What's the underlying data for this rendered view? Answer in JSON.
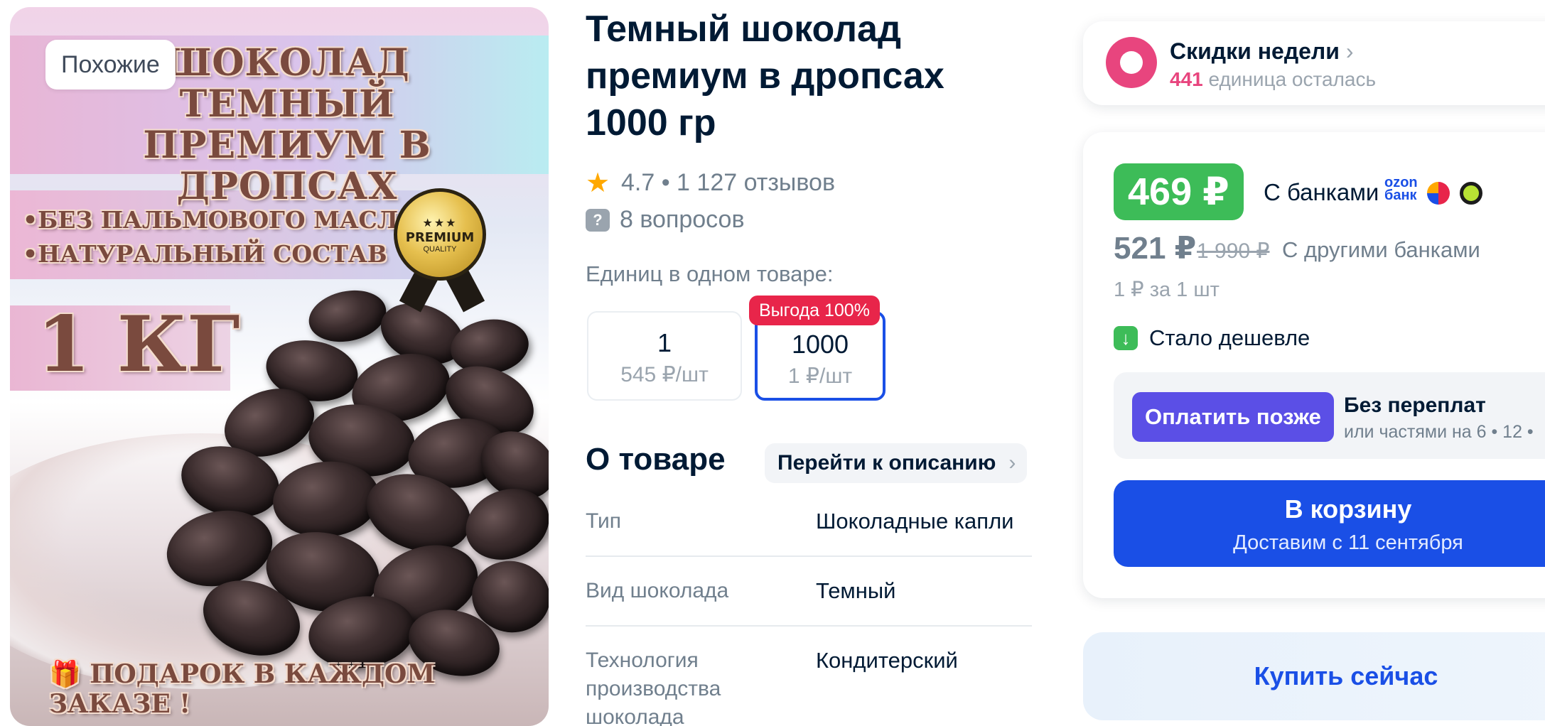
{
  "gallery": {
    "similar_chip": "Похожие",
    "image_title": "ШОКОЛАД ТЕМНЫЙ ПРЕМИУМ В ДРОПСАХ",
    "feature_1": "•БЕЗ ПАЛЬМОВОГО МАСЛА",
    "feature_2": "•НАТУРАЛЬНЫЙ СОСТАВ",
    "weight": "1 КГ",
    "gift_text": "ПОДАРОК В КАЖДОМ ЗАКАЗЕ !",
    "seal_top": "PREMIUM",
    "seal_bottom": "QUALITY",
    "seal_stars": "★★★"
  },
  "product": {
    "title": "Темный шоколад премиум в дропсах 1000 гр",
    "rating_text": "4.7 • 1 127 отзывов",
    "questions_text": "8 вопросов"
  },
  "units": {
    "label": "Единиц в одном товаре:",
    "benefit_tag": "Выгода 100%",
    "options": [
      {
        "count": "1",
        "price_per": "545 ₽/шт",
        "selected": false
      },
      {
        "count": "1000",
        "price_per": "1 ₽/шт",
        "selected": true
      }
    ]
  },
  "about": {
    "title": "О товаре",
    "goto_label": "Перейти к описанию",
    "specs": [
      {
        "key": "Тип",
        "value": "Шоколадные капли"
      },
      {
        "key": "Вид шоколада",
        "value": "Темный"
      },
      {
        "key": "Технология производства шоколада",
        "value": "Кондитерский"
      }
    ]
  },
  "promo": {
    "title": "Скидки недели",
    "count": "441",
    "subtitle": "единица осталась"
  },
  "price": {
    "card_price": "469 ₽",
    "with_banks": "С банками",
    "ozon_bank": "ozon банк",
    "regular_price": "521 ₽",
    "crossed_price": "1 990 ₽",
    "other_banks": "С другими банками",
    "per_unit": "1 ₽ за 1 шт",
    "cheaper": "Стало дешевле",
    "pay_later_button": "Оплатить позже",
    "no_overpay": "Без переплат",
    "parts_text": "или частями на 6 • 12 •",
    "cart_button": "В корзину",
    "delivery": "Доставим с 11 сентября",
    "buy_now": "Купить сейчас"
  },
  "colors": {
    "accent_blue": "#1a4fe6",
    "price_green": "#3dbc58",
    "benefit_red": "#e8254a",
    "promo_pink": "#e8457e",
    "pay_later_purple": "#5b4fe6"
  }
}
